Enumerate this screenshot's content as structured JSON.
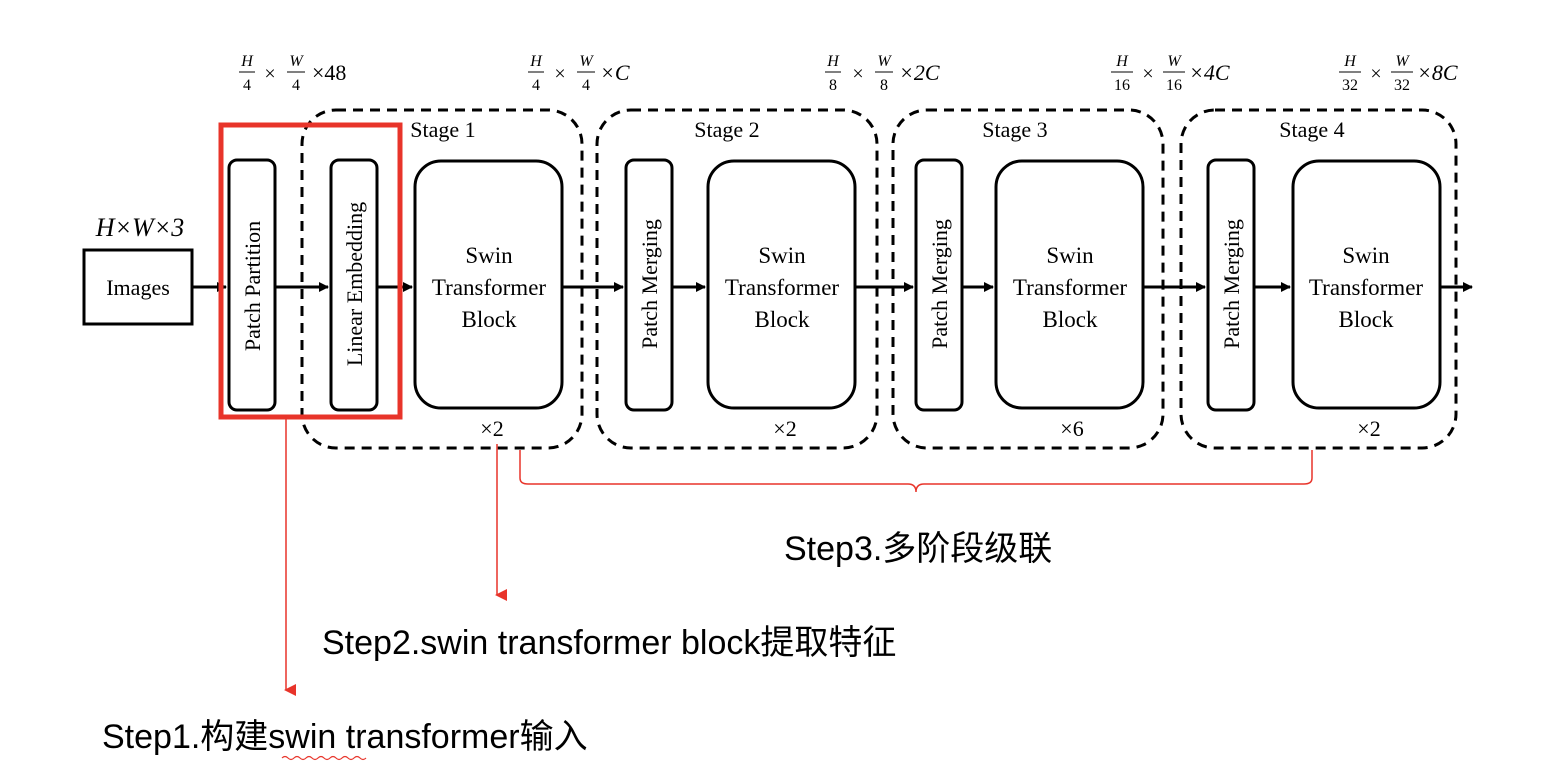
{
  "input": {
    "dim": "H×W×3",
    "label": "Images"
  },
  "modules": {
    "patch_partition": "Patch Partition",
    "linear_embedding": "Linear Embedding",
    "patch_merging": "Patch Merging",
    "swin_block": [
      "Swin",
      "Transformer",
      "Block"
    ]
  },
  "stages": [
    {
      "label": "Stage 1",
      "repeat": "×2",
      "dim": {
        "h_num": "H",
        "h_den": "4",
        "w_num": "W",
        "w_den": "4",
        "tail": "×C"
      }
    },
    {
      "label": "Stage 2",
      "repeat": "×2",
      "dim": {
        "h_num": "H",
        "h_den": "8",
        "w_num": "W",
        "w_den": "8",
        "tail": "×2C"
      }
    },
    {
      "label": "Stage 3",
      "repeat": "×6",
      "dim": {
        "h_num": "H",
        "h_den": "16",
        "w_num": "W",
        "w_den": "16",
        "tail": "×4C"
      }
    },
    {
      "label": "Stage 4",
      "repeat": "×2",
      "dim": {
        "h_num": "H",
        "h_den": "32",
        "w_num": "W",
        "w_den": "32",
        "tail": "×8C"
      }
    }
  ],
  "partition_dim": {
    "h_num": "H",
    "h_den": "4",
    "w_num": "W",
    "w_den": "4",
    "tail": "×48"
  },
  "annotations": {
    "step1": "Step1.构建swin transformer输入",
    "step2": "Step2.swin transformer block提取特征",
    "step3": "Step3.多阶段级联"
  },
  "colors": {
    "highlight": "#e8342a",
    "annotation_line": "#e8342a",
    "brace": "#e8342a"
  }
}
